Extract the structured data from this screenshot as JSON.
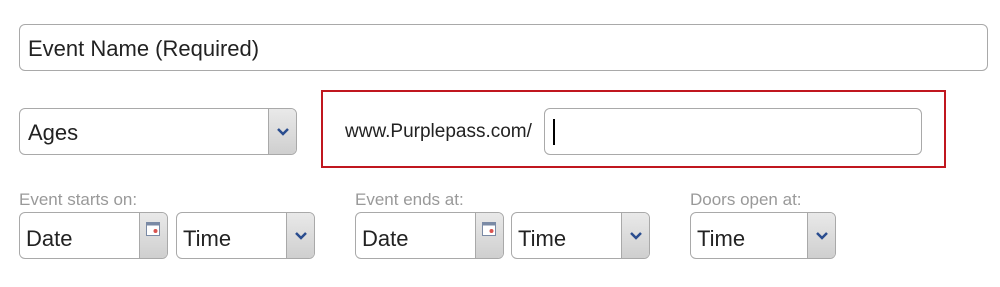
{
  "event_name": {
    "placeholder": "Event Name (Required)"
  },
  "ages": {
    "selected": "Ages"
  },
  "url": {
    "prefix": "www.Purplepass.com/",
    "value": ""
  },
  "starts": {
    "label": "Event starts on:",
    "date": "Date",
    "time": "Time"
  },
  "ends": {
    "label": "Event ends at:",
    "date": "Date",
    "time": "Time"
  },
  "doors": {
    "label": "Doors open at:",
    "time": "Time"
  },
  "colors": {
    "highlight_border": "#c0171f",
    "chevron": "#2a4d8f",
    "label": "#999999"
  }
}
